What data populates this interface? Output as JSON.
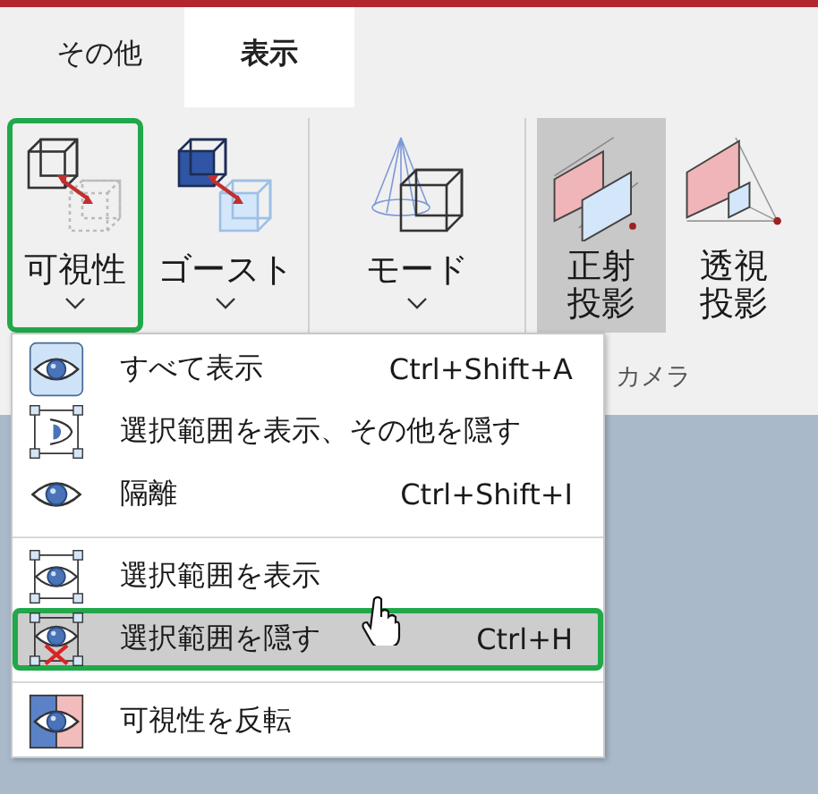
{
  "tabs": [
    {
      "label": "その他",
      "selected": false
    },
    {
      "label": "表示",
      "selected": true
    }
  ],
  "ribbon": {
    "groups": [
      {
        "buttons": [
          {
            "kind": "visibility",
            "label": "可視性",
            "dropdown": true,
            "selected": false,
            "highlighted": true
          },
          {
            "kind": "ghost",
            "label": "ゴースト",
            "dropdown": true,
            "selected": false,
            "highlighted": false
          }
        ]
      },
      {
        "buttons": [
          {
            "kind": "mode",
            "label": "モード",
            "dropdown": true,
            "selected": false,
            "highlighted": false
          }
        ]
      },
      {
        "label": "カメラ",
        "buttons": [
          {
            "kind": "orthographic",
            "label": "正射投影",
            "dropdown": false,
            "selected": true,
            "highlighted": false
          },
          {
            "kind": "perspective",
            "label": "透視投影",
            "dropdown": false,
            "selected": false,
            "highlighted": false
          }
        ]
      }
    ]
  },
  "menu": {
    "items": [
      {
        "kind": "show-all",
        "label": "すべて表示",
        "shortcut": "Ctrl+Shift+A",
        "separator_before": false,
        "hovered": false,
        "highlighted": false
      },
      {
        "kind": "show-selection-hide-others",
        "label": "選択範囲を表示、その他を隠す",
        "separator_before": false,
        "hovered": false,
        "highlighted": false
      },
      {
        "kind": "isolate",
        "label": "隔離",
        "shortcut": "Ctrl+Shift+I",
        "separator_before": false,
        "hovered": false,
        "highlighted": false
      },
      {
        "kind": "show-selection",
        "label": "選択範囲を表示",
        "separator_before": true,
        "hovered": false,
        "highlighted": false
      },
      {
        "kind": "hide-selection",
        "label": "選択範囲を隠す",
        "shortcut": "Ctrl+H",
        "separator_before": false,
        "hovered": true,
        "highlighted": true
      },
      {
        "kind": "invert",
        "label": "可視性を反転",
        "separator_before": true,
        "hovered": false,
        "highlighted": false
      }
    ]
  }
}
